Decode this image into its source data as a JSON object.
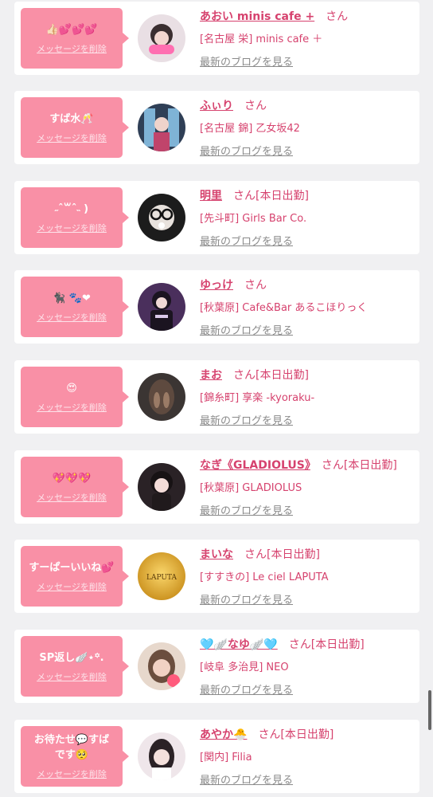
{
  "colors": {
    "accent": "#f990a6",
    "name_text": "#d6426e",
    "link_gray": "#8a8a8a",
    "background": "#f0f0f2"
  },
  "delete_label": "メッセージを削除",
  "blog_label": "最新のブログを見る",
  "cards": [
    {
      "message": "👍🏻💕💕💕",
      "name": "あおい minis cafe +",
      "suffix": "さん",
      "shop": "[名古屋 栄] minis cafe ＋"
    },
    {
      "message": "すば水🥂",
      "name": "ふぃり",
      "suffix": "さん",
      "shop": "[名古屋 錦] 乙女坂42"
    },
    {
      "message": "˶ˆ꒳ˆ˵ )",
      "name": "明里",
      "suffix": "さん[本日出勤]",
      "shop": "[先斗町] Girls Bar Co."
    },
    {
      "message": "🐈‍⬛‪‪ ‪🐾❤︎",
      "name": "ゆっけ",
      "suffix": "さん",
      "shop": "[秋葉原] Cafe&Bar あるこほりっく"
    },
    {
      "message": "😍",
      "name": "まお",
      "suffix": "さん[本日出勤]",
      "shop": "[錦糸町] 享楽 -kyoraku-"
    },
    {
      "message": "💖💖💖",
      "name": "なぎ《GLADIOLUS》",
      "suffix": "さん[本日出勤]",
      "shop": "[秋葉原] GLADIOLUS"
    },
    {
      "message": "すーぱーいいね💕",
      "name": "まいな",
      "suffix": "さん[本日出勤]",
      "shop": "[すすきの] Le ciel LAPUTA"
    },
    {
      "message": "SP返し🪽⋆꙳.",
      "name": "🩵🪽なゆ🪽🩵",
      "suffix": "さん[本日出勤]",
      "shop": "[岐阜 多治見] NEO"
    },
    {
      "message": "お待たせ💬すば\nです🥺",
      "name": "あやか🐣",
      "suffix": "さん[本日出勤]",
      "shop": "[関内] Filia"
    }
  ]
}
